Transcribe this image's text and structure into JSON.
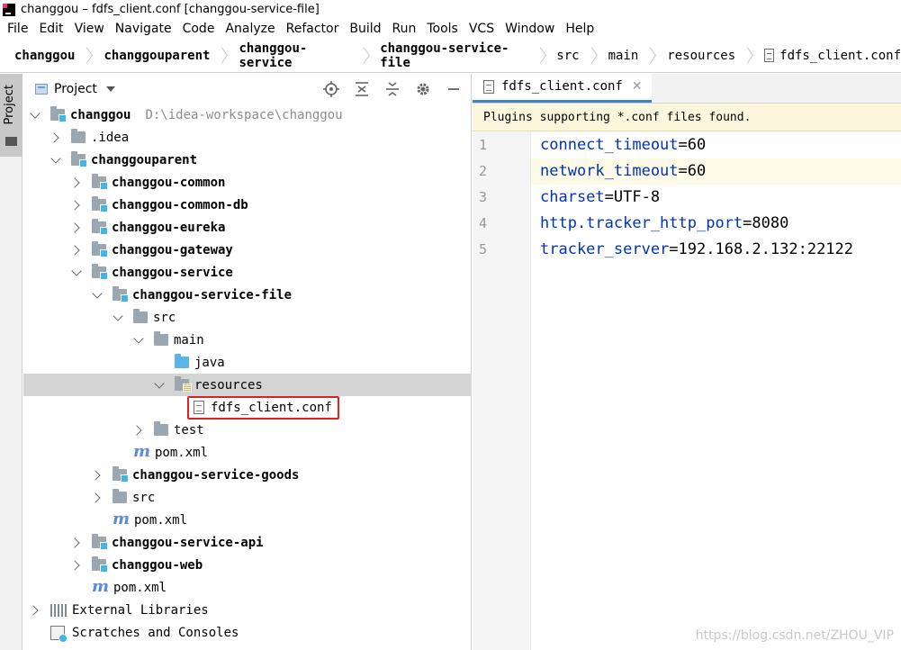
{
  "window": {
    "title": "changgou – fdfs_client.conf [changgou-service-file]"
  },
  "menu": [
    "File",
    "Edit",
    "View",
    "Navigate",
    "Code",
    "Analyze",
    "Refactor",
    "Build",
    "Run",
    "Tools",
    "VCS",
    "Window",
    "Help"
  ],
  "breadcrumbs": [
    "changgou",
    "changgouparent",
    "changgou-service",
    "changgou-service-file",
    "src",
    "main",
    "resources",
    "fdfs_client.conf"
  ],
  "side_tab": {
    "label": "Project"
  },
  "project_panel": {
    "title": "Project"
  },
  "tree": [
    {
      "label": "changgou",
      "path": "D:\\idea-workspace\\changgou",
      "state": "open",
      "icon": "module-folder",
      "bold": true
    },
    {
      "label": ".idea",
      "state": "closed",
      "icon": "folder"
    },
    {
      "label": "changgouparent",
      "state": "open",
      "icon": "module-folder",
      "bold": true
    },
    {
      "label": "changgou-common",
      "state": "closed",
      "icon": "module-folder",
      "bold": true
    },
    {
      "label": "changgou-common-db",
      "state": "closed",
      "icon": "module-folder",
      "bold": true
    },
    {
      "label": "changgou-eureka",
      "state": "closed",
      "icon": "module-folder",
      "bold": true
    },
    {
      "label": "changgou-gateway",
      "state": "closed",
      "icon": "module-folder",
      "bold": true
    },
    {
      "label": "changgou-service",
      "state": "open",
      "icon": "module-folder",
      "bold": true
    },
    {
      "label": "changgou-service-file",
      "state": "open",
      "icon": "module-folder",
      "bold": true
    },
    {
      "label": "src",
      "state": "open",
      "icon": "folder"
    },
    {
      "label": "main",
      "state": "open",
      "icon": "folder"
    },
    {
      "label": "java",
      "state": "none",
      "icon": "java-folder"
    },
    {
      "label": "resources",
      "state": "open",
      "icon": "resources-folder",
      "selected": true
    },
    {
      "label": "fdfs_client.conf",
      "state": "none",
      "icon": "conf-file",
      "highlighted": true
    },
    {
      "label": "test",
      "state": "closed",
      "icon": "folder"
    },
    {
      "label": "pom.xml",
      "state": "none",
      "icon": "maven-file"
    },
    {
      "label": "changgou-service-goods",
      "state": "closed",
      "icon": "module-folder",
      "bold": true
    },
    {
      "label": "src",
      "state": "closed",
      "icon": "folder"
    },
    {
      "label": "pom.xml",
      "state": "none",
      "icon": "maven-file"
    },
    {
      "label": "changgou-service-api",
      "state": "closed",
      "icon": "module-folder",
      "bold": true
    },
    {
      "label": "changgou-web",
      "state": "closed",
      "icon": "module-folder",
      "bold": true
    },
    {
      "label": "pom.xml",
      "state": "none",
      "icon": "maven-file"
    },
    {
      "label": "External Libraries",
      "state": "closed",
      "icon": "libraries"
    },
    {
      "label": "Scratches and Consoles",
      "state": "none",
      "icon": "scratches"
    }
  ],
  "editor": {
    "tab": "fdfs_client.conf",
    "banner": "Plugins supporting *.conf files found.",
    "lines": [
      {
        "num": "1",
        "key": "connect_timeout",
        "value": "60"
      },
      {
        "num": "2",
        "key": "network_timeout",
        "value": "60"
      },
      {
        "num": "3",
        "key": "charset",
        "value": "UTF-8"
      },
      {
        "num": "4",
        "key": "http.tracker_http_port",
        "value": "8080"
      },
      {
        "num": "5",
        "key": "tracker_server",
        "value": "192.168.2.132:22122"
      }
    ],
    "current_line": 2
  },
  "watermark": "https://blog.csdn.net/ZHOU_VIP",
  "colors": {
    "accent": "#4083c9",
    "highlight_border": "#e02020",
    "banner_bg": "#fbf6dc",
    "key_color": "#0033b3"
  }
}
